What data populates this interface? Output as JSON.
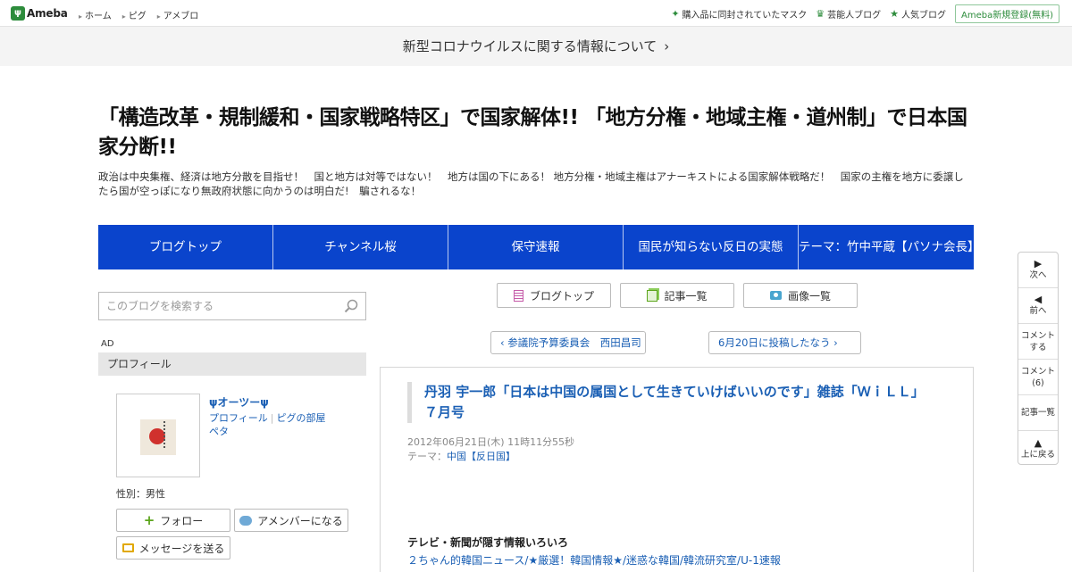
{
  "topbar": {
    "logo_text": "Ameba",
    "nav": [
      "ホーム",
      "ピグ",
      "アメブロ"
    ],
    "right_links": [
      {
        "label": "購入品に同封されていたマスク",
        "icon": "sparkle-icon"
      },
      {
        "label": "芸能人ブログ",
        "icon": "crown-icon"
      },
      {
        "label": "人気ブログ",
        "icon": "star-icon"
      }
    ],
    "register_label": "Ameba新規登録(無料)"
  },
  "banner": {
    "text": "新型コロナウイルスに関する情報について"
  },
  "blog": {
    "title": "「構造改革・規制緩和・国家戦略特区」で国家解体!! 「地方分権・地域主権・道州制」で日本国家分断!!",
    "description": "政治は中央集権、経済は地方分散を目指せ！　国と地方は対等ではない！　地方は国の下にある！ 地方分権・地域主権はアナーキストによる国家解体戦略だ！　国家の主権を地方に委譲したら国が空っぽになり無政府状態に向かうのは明白だ!　騙されるな！"
  },
  "nav": [
    "ブログトップ",
    "チャンネル桜",
    "保守速報",
    "国民が知らない反日の実態",
    "テーマ：竹中平蔵【パソナ会長】"
  ],
  "sidebar": {
    "search_placeholder": "このブログを検索する",
    "ad_label": "AD",
    "profile_heading": "プロフィール",
    "name": "ψオーツーψ",
    "link_profile": "プロフィール",
    "link_pig": "ピグの部屋",
    "link_peta": "ペタ",
    "gender": "性別：男性",
    "follow": "フォロー",
    "amember": "アメンバーになる",
    "message": "メッセージを送る"
  },
  "content": {
    "btn_top": "ブログトップ",
    "btn_list": "記事一覧",
    "btn_images": "画像一覧",
    "prev": "参議院予算委員会　西田昌司",
    "next": "6月20日に投稿したなう"
  },
  "article": {
    "title": "丹羽 宇一郎「日本は中国の属国として生きていけばいいのです」雑誌「ＷｉＬＬ」７月号",
    "date": "2012年06月21日(木) 11時11分55秒",
    "theme_label": "テーマ：",
    "theme": "中国【反日国】",
    "subheading": "テレビ・新聞が隠す情報いろいろ",
    "links": "２ちゃん的韓国ニュース/★厳選！韓国情報★/迷惑な韓国/韓流研究室/U-1速報"
  },
  "side_menu": {
    "next": "次へ",
    "prev": "前へ",
    "comment": "コメント\nする",
    "comment_count_label": "コメント",
    "comment_count": "(6)",
    "list": "記事一覧",
    "top": "上に戻る"
  },
  "colors": {
    "nav_bg": "#0a44cc",
    "link": "#1a5fb4",
    "ameba_green": "#2d8c3c"
  }
}
